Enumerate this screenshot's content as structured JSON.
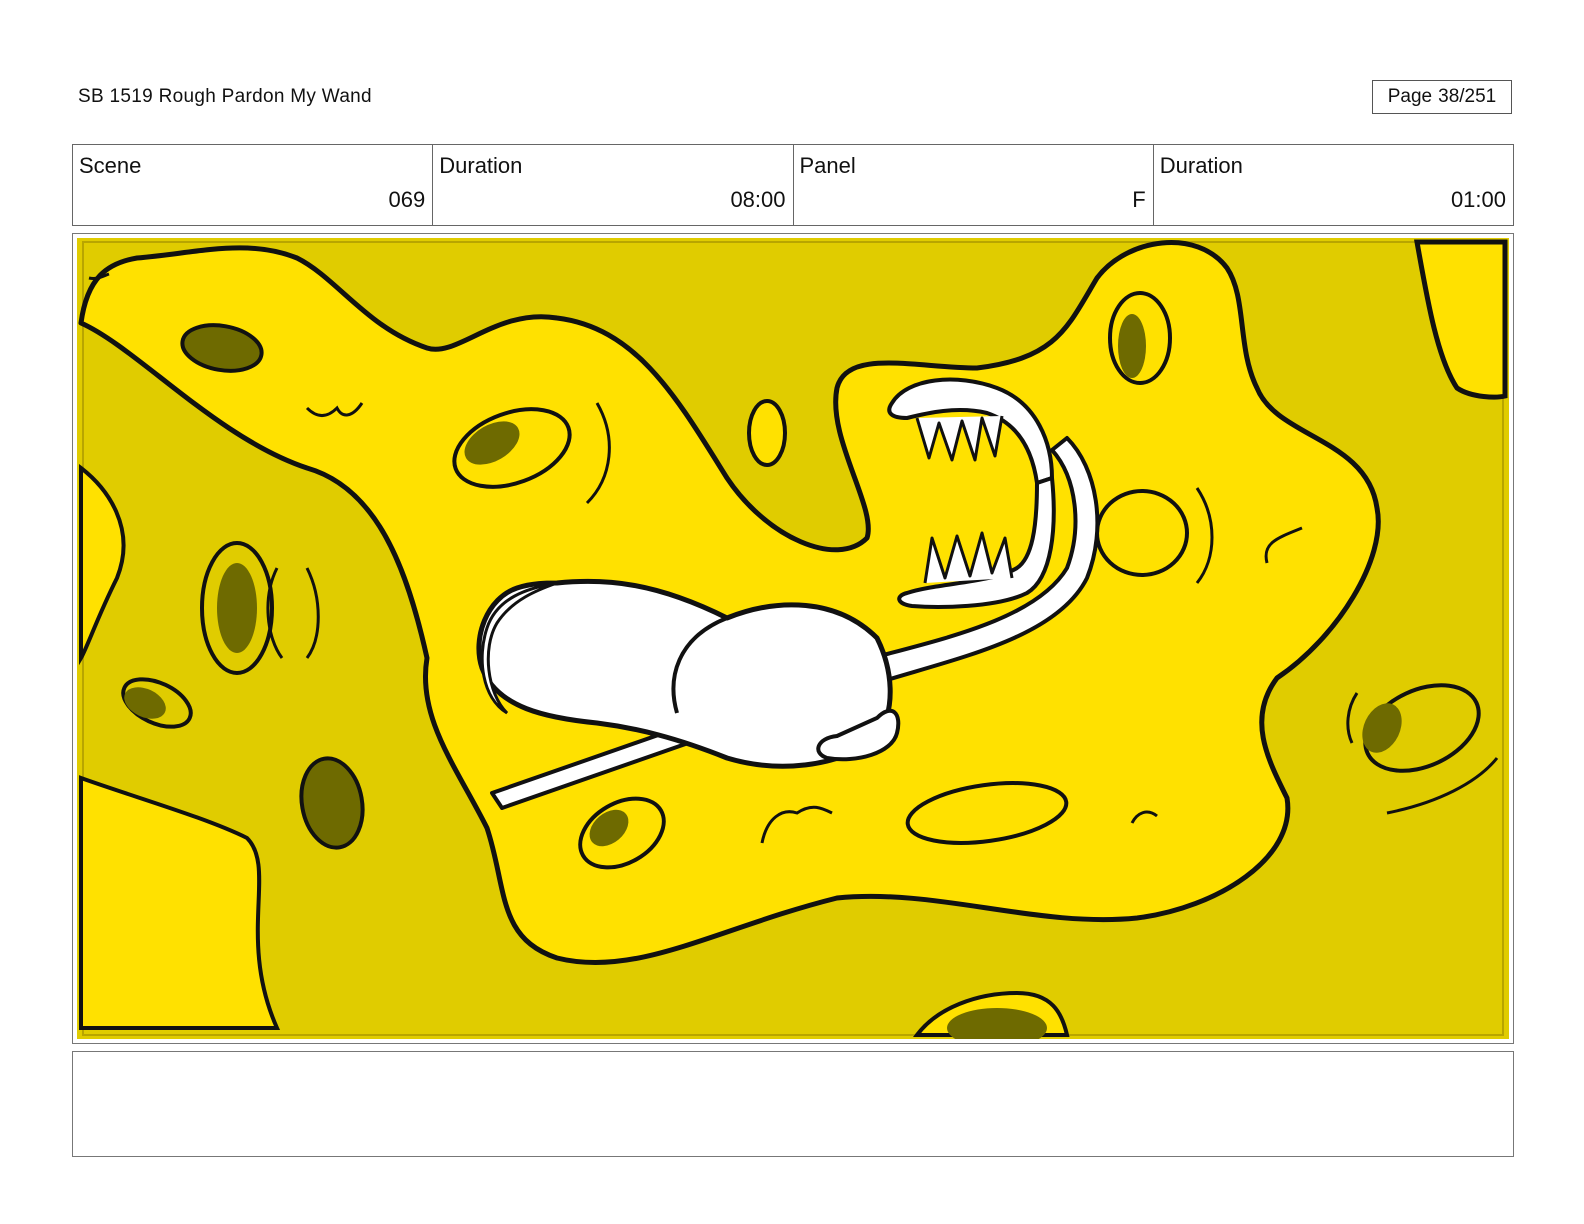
{
  "header": {
    "title": "SB 1519 Rough  Pardon My Wand",
    "page_label": "Page",
    "page_number": "38/251"
  },
  "info": {
    "scene_label": "Scene",
    "scene_value": "069",
    "scene_duration_label": "Duration",
    "scene_duration_value": "08:00",
    "panel_label": "Panel",
    "panel_value": "F",
    "panel_duration_label": "Duration",
    "panel_duration_value": "01:00"
  },
  "notes": "",
  "colors": {
    "bright_yellow": "#FFE100",
    "olive_yellow": "#E0CC00",
    "hole_shadow": "#6E6A00",
    "ink": "#111111"
  }
}
